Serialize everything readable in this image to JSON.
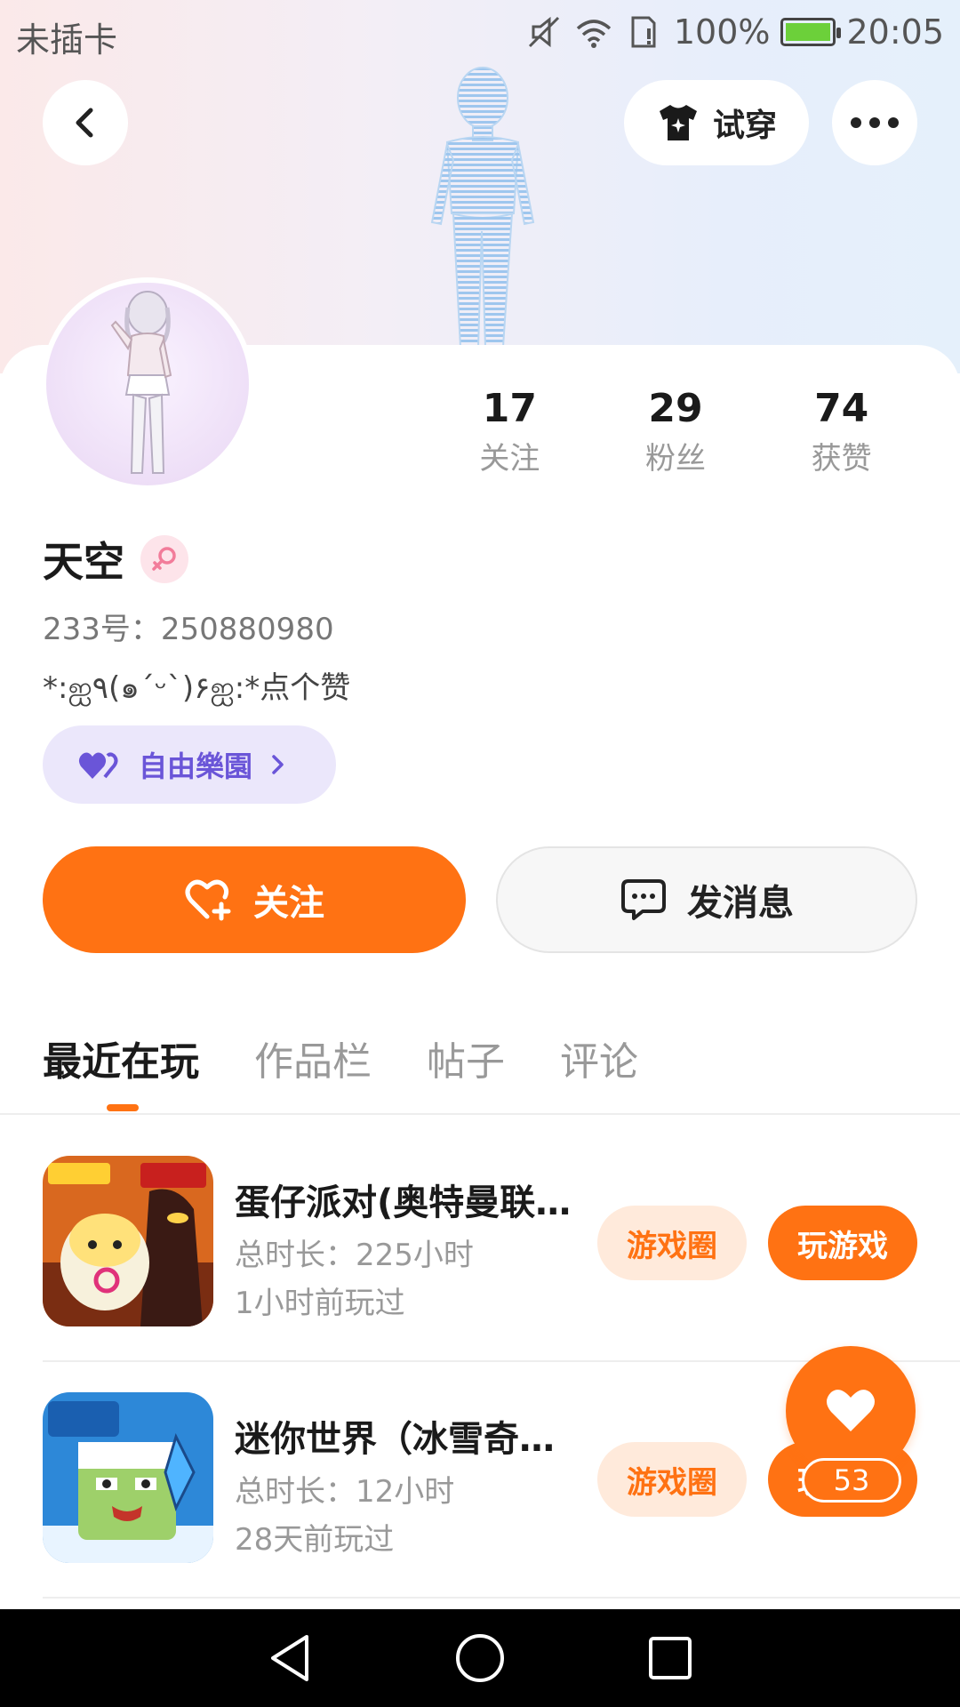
{
  "status_bar": {
    "carrier": "未插卡",
    "battery": "100%",
    "time": "20:05"
  },
  "header": {
    "try_on_label": "试穿"
  },
  "profile": {
    "name": "天空",
    "id_text": "233号：250880980",
    "bio": "*:ஐ٩(๑´ᵕ`)۶ஐ:*点个赞",
    "club_label": "自由樂園",
    "stats": [
      {
        "value": "17",
        "label": "关注"
      },
      {
        "value": "29",
        "label": "粉丝"
      },
      {
        "value": "74",
        "label": "获赞"
      }
    ]
  },
  "actions": {
    "follow_label": "关注",
    "message_label": "发消息"
  },
  "tabs": [
    {
      "label": "最近在玩",
      "active": true
    },
    {
      "label": "作品栏",
      "active": false
    },
    {
      "label": "帖子",
      "active": false
    },
    {
      "label": "评论",
      "active": false
    }
  ],
  "games": [
    {
      "title": "蛋仔派对(奥特曼联…",
      "duration": "总时长：225小时",
      "last_played": "1小时前玩过",
      "circle_label": "游戏圈",
      "play_label": "玩游戏"
    },
    {
      "title": "迷你世界（冰雪奇…",
      "duration": "总时长：12小时",
      "last_played": "28天前玩过",
      "circle_label": "游戏圈",
      "play_label": "玩游戏"
    }
  ],
  "like_fab": {
    "count": "53"
  },
  "colors": {
    "accent": "#ff7213",
    "club_purple": "#6a55d8"
  }
}
